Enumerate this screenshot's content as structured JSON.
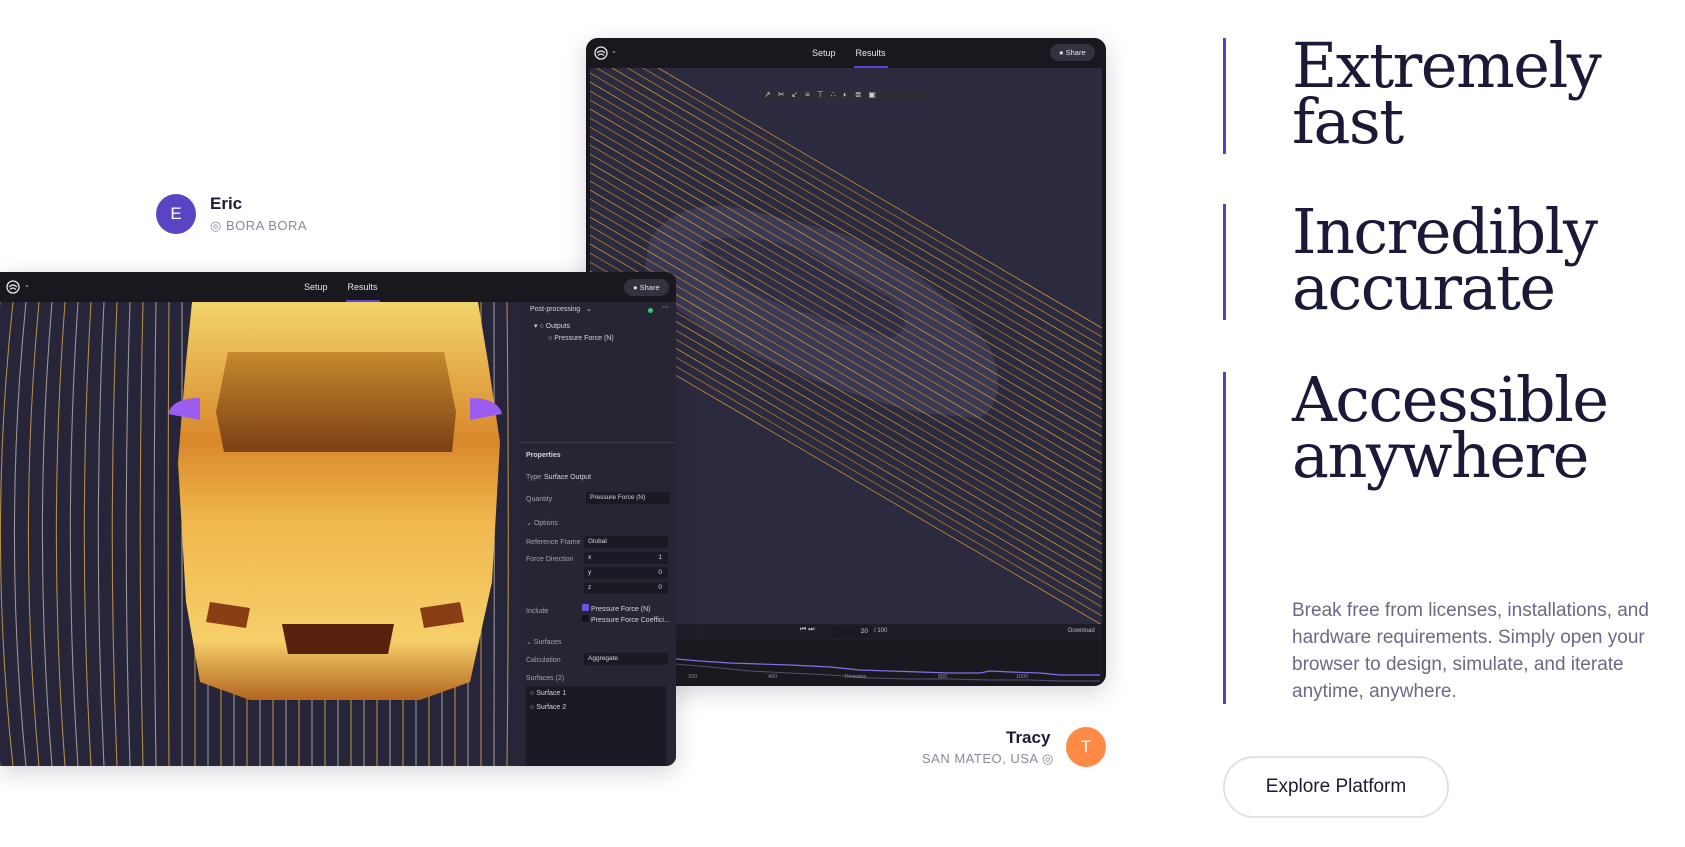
{
  "headlines": [
    {
      "line1": "Extremely",
      "line2": "fast"
    },
    {
      "line1": "Incredibly",
      "line2": "accurate"
    },
    {
      "line1": "Accessible",
      "line2": "anywhere"
    }
  ],
  "description": "Break free from licenses, installations, and hardware requirements. Simply open your browser to design, simulate, and iterate anytime, anywhere.",
  "cta_label": "Explore Platform",
  "people": [
    {
      "initial": "E",
      "name": "Eric",
      "location": "BORA BORA",
      "color": "#5b44c4"
    },
    {
      "initial": "T",
      "name": "Tracy",
      "location": "SAN MATEO, USA",
      "color": "#ff8a45"
    }
  ],
  "app": {
    "tabs": [
      "Setup",
      "Results"
    ],
    "active_tab": "Results",
    "share_label": "Share",
    "timeline": {
      "frame": "20",
      "total": "/ 100",
      "download": "Download",
      "ticks": [
        "200",
        "400",
        "Timestep",
        "800",
        "1000"
      ]
    },
    "panel": {
      "header": "Post-processing",
      "tree_outputs": "Outputs",
      "tree_item": "Pressure Force (N)",
      "properties_title": "Properties",
      "type_label": "Type",
      "type_value": "Surface Output",
      "quantity_label": "Quantity",
      "quantity_value": "Pressure Force (N)",
      "options_label": "Options",
      "ref_frame_label": "Reference Frame",
      "ref_frame_value": "Global",
      "force_dir_label": "Force Direction",
      "force_x": "1",
      "force_y": "0",
      "force_z": "0",
      "axis_x": "x",
      "axis_y": "y",
      "axis_z": "z",
      "include_label": "Include",
      "include_opt1": "Pressure Force (N)",
      "include_opt2": "Pressure Force Coeffici...",
      "surfaces_section": "Surfaces",
      "calculation_label": "Calculation",
      "calculation_value": "Aggregate",
      "surfaces_count": "Surfaces (2)",
      "surface1": "Surface 1",
      "surface2": "Surface 2"
    }
  },
  "colors": {
    "accent": "#5440c4",
    "dark_bg": "#18171f",
    "viewport_bg": "#2b2a3e",
    "streamline": "#e8a23a"
  }
}
